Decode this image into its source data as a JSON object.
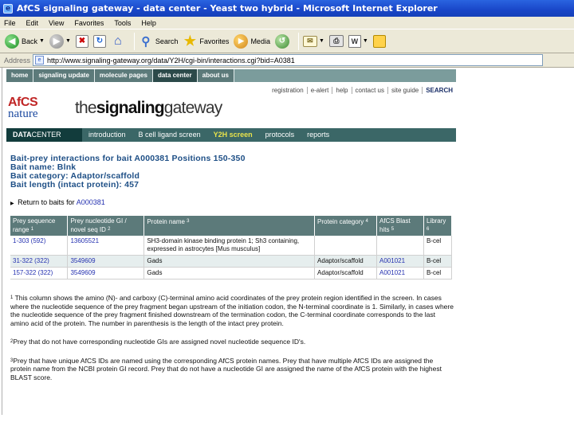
{
  "window": {
    "title": "AfCS signaling gateway - data center - Yeast two hybrid - Microsoft Internet Explorer"
  },
  "menu": [
    "File",
    "Edit",
    "View",
    "Favorites",
    "Tools",
    "Help"
  ],
  "toolbar": {
    "back": "Back",
    "search": "Search",
    "favorites": "Favorites",
    "media": "Media"
  },
  "address": {
    "label": "Address",
    "url": "http://www.signaling-gateway.org/data/Y2H/cgi-bin/interactions.cgi?bid=A0381"
  },
  "site": {
    "topnav": [
      "home",
      "signaling update",
      "molecule pages",
      "data center",
      "about us"
    ],
    "active_topnav": "data center",
    "utility": [
      "registration",
      "e-alert",
      "help",
      "contact us",
      "site guide",
      "SEARCH"
    ],
    "logo_top": "AfCS",
    "logo_bottom": "nature",
    "brand_light_1": "the",
    "brand_bold": "signaling",
    "brand_light_2": "gateway",
    "datacenter_1": "DATA",
    "datacenter_2": "CENTER",
    "mainnav": [
      "introduction",
      "B cell ligand screen",
      "Y2H screen",
      "protocols",
      "reports"
    ],
    "active_mainnav": "Y2H screen"
  },
  "heading": {
    "line1": "Bait-prey interactions for bait A000381 Positions 150-350",
    "line2": "Bait name: Blnk",
    "line3": "Bait category: Adaptor/scaffold",
    "line4": "Bait length (intact protein): 457"
  },
  "backlink": {
    "prefix": "Return to baits for",
    "link": "A000381"
  },
  "table": {
    "headers": [
      {
        "text": "Prey sequence range",
        "sup": "1"
      },
      {
        "text": "Prey nucleotide GI / novel seq ID",
        "sup": "2"
      },
      {
        "text": "Protein name",
        "sup": "3"
      },
      {
        "text": "Protein category",
        "sup": "4"
      },
      {
        "text": "AfCS Blast hits",
        "sup": "5"
      },
      {
        "text": "Library",
        "sup": "6"
      }
    ],
    "rows": [
      {
        "range": "1-303 (592)",
        "gi": "13605521",
        "name": "SH3-domain kinase binding protein 1; Sh3 containing, expressed in astrocytes [Mus musculus]",
        "category": "",
        "blast": "",
        "library": "B-cel"
      },
      {
        "range": "31-322 (322)",
        "gi": "3549609",
        "name": "Gads",
        "category": "Adaptor/scaffold",
        "blast": "A001021",
        "library": "B-cel"
      },
      {
        "range": "157-322 (322)",
        "gi": "3549609",
        "name": "Gads",
        "category": "Adaptor/scaffold",
        "blast": "A001021",
        "library": "B-cel"
      }
    ]
  },
  "footnotes": [
    {
      "sup": "1",
      "text": "This column shows the amino (N)- and carboxy (C)-terminal amino acid coordinates of the prey protein region identified in the screen. In cases where the nucleotide sequence of the prey fragment began upstream of the initiation codon, the N-terminal coordinate is 1. Similarly, in cases where the nucleotide sequence of the prey fragment finished downstream of the termination codon, the C-terminal coordinate corresponds to the last amino acid of the protein. The number in parenthesis is the length of the intact prey protein."
    },
    {
      "sup": "2",
      "text": "Prey that do not have corresponding nucleotide GIs are assigned novel nucleotide sequence ID's."
    },
    {
      "sup": "3",
      "text": "Prey that have unique AfCS IDs are named using the corresponding AfCS protein names. Prey that have multiple AfCS IDs are assigned the protein name from the NCBI protein GI record. Prey that do not have a nucleotide GI are assigned the name of the AfCS protein with the highest BLAST score."
    }
  ]
}
